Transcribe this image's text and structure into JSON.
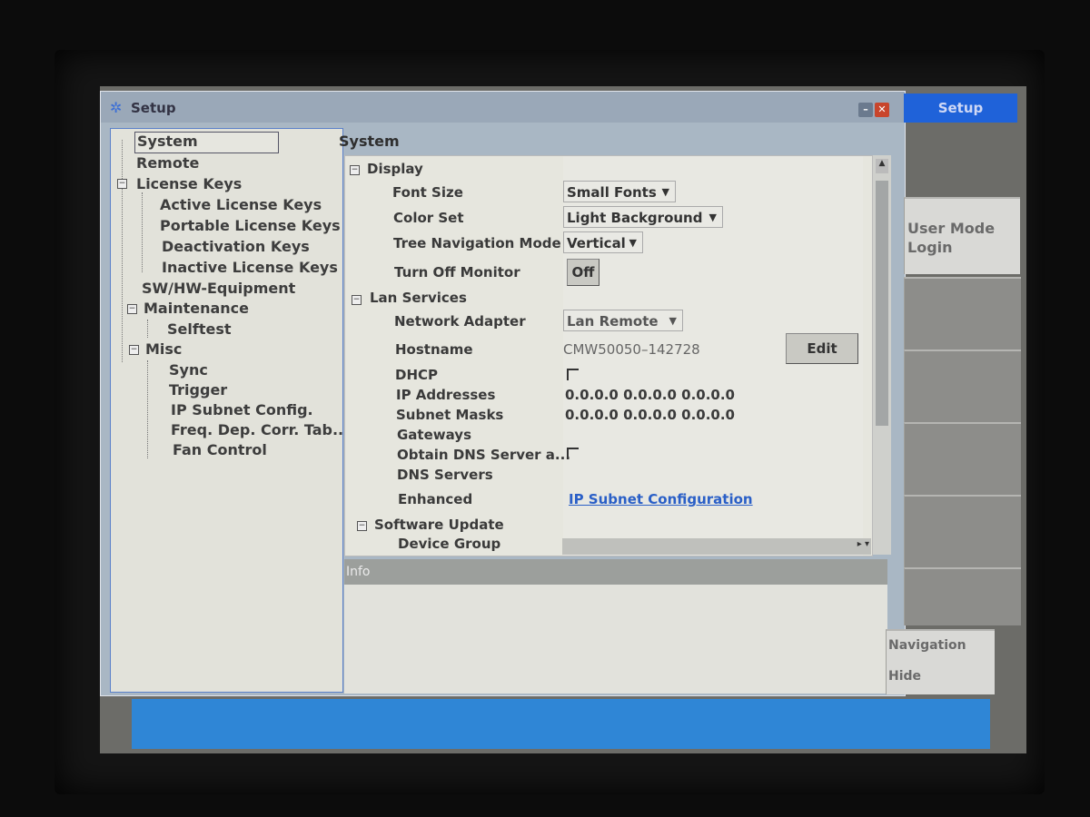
{
  "window": {
    "title": "Setup"
  },
  "softkeys": {
    "setup": "Setup",
    "user_mode_line1": "User Mode",
    "user_mode_line2": "Login",
    "navigation": "Navigation",
    "hide": "Hide"
  },
  "tree": {
    "items": [
      "System",
      "Remote",
      "License Keys",
      "Active License Keys",
      "Portable License Keys",
      "Deactivation Keys",
      "Inactive License Keys",
      "SW/HW-Equipment",
      "Maintenance",
      "Selftest",
      "Misc",
      "Sync",
      "Trigger",
      "IP Subnet Config.",
      "Freq. Dep. Corr. Tab...",
      "Fan Control"
    ]
  },
  "pane": {
    "title": "System",
    "display": {
      "label": "Display",
      "font_size": {
        "label": "Font Size",
        "value": "Small Fonts"
      },
      "color_set": {
        "label": "Color Set",
        "value": "Light Background"
      },
      "tree_nav": {
        "label": "Tree Navigation Mode",
        "value": "Vertical"
      },
      "turn_off": {
        "label": "Turn Off Monitor",
        "button": "Off"
      }
    },
    "lan": {
      "label": "Lan Services",
      "network_adapter": {
        "label": "Network Adapter",
        "value": "Lan Remote"
      },
      "hostname": {
        "label": "Hostname",
        "value": "CMW50050–142728",
        "button": "Edit"
      },
      "dhcp": {
        "label": "DHCP"
      },
      "ip_addresses": {
        "label": "IP Addresses",
        "value": "0.0.0.0 0.0.0.0 0.0.0.0"
      },
      "subnet_masks": {
        "label": "Subnet Masks",
        "value": "0.0.0.0 0.0.0.0 0.0.0.0"
      },
      "gateways": {
        "label": "Gateways"
      },
      "obtain_dns": {
        "label": "Obtain DNS Server a..."
      },
      "dns_servers": {
        "label": "DNS Servers"
      },
      "enhanced": {
        "label": "Enhanced",
        "link": "IP Subnet Configuration"
      }
    },
    "software_update": {
      "label": "Software Update",
      "device_group": {
        "label": "Device Group"
      }
    },
    "info_label": "Info"
  }
}
